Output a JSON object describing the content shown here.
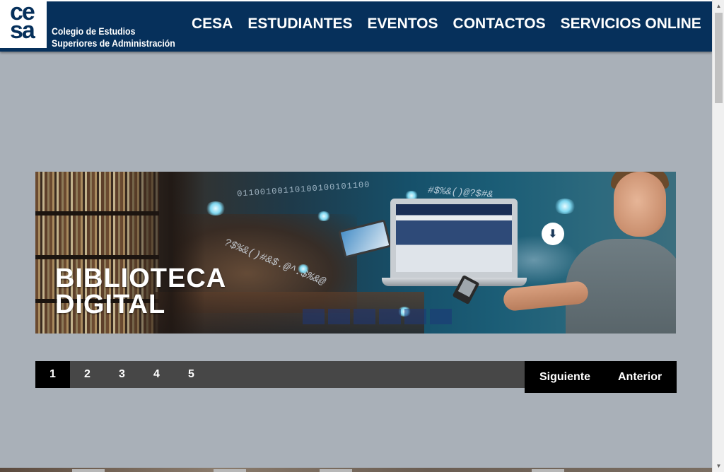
{
  "header": {
    "logo_mark_top": "ce",
    "logo_mark_bottom": "sa",
    "logo_line1": "Colegio de Estudios",
    "logo_line2": "Superiores de Administración",
    "nav": [
      {
        "label": "CESA"
      },
      {
        "label": "ESTUDIANTES"
      },
      {
        "label": "EVENTOS"
      },
      {
        "label": "CONTACTOS"
      },
      {
        "label": "SERVICIOS ONLINE"
      }
    ]
  },
  "banner": {
    "title_line1": "BIBLIOTECA",
    "title_line2": "DIGITAL",
    "binary_text": "01100100110100100101100",
    "symbols_top": "#$%&()@?$#&",
    "symbols_low": "?$%&()#&$.@^.$%&@"
  },
  "pager": {
    "pages": [
      "1",
      "2",
      "3",
      "4",
      "5"
    ],
    "active_page": "1",
    "next_label": "Siguiente",
    "prev_label": "Anterior"
  },
  "colors": {
    "header_bg": "#06305b",
    "page_bg": "#a9b0b8",
    "pager_bg": "#474747",
    "pager_active": "#000000"
  }
}
